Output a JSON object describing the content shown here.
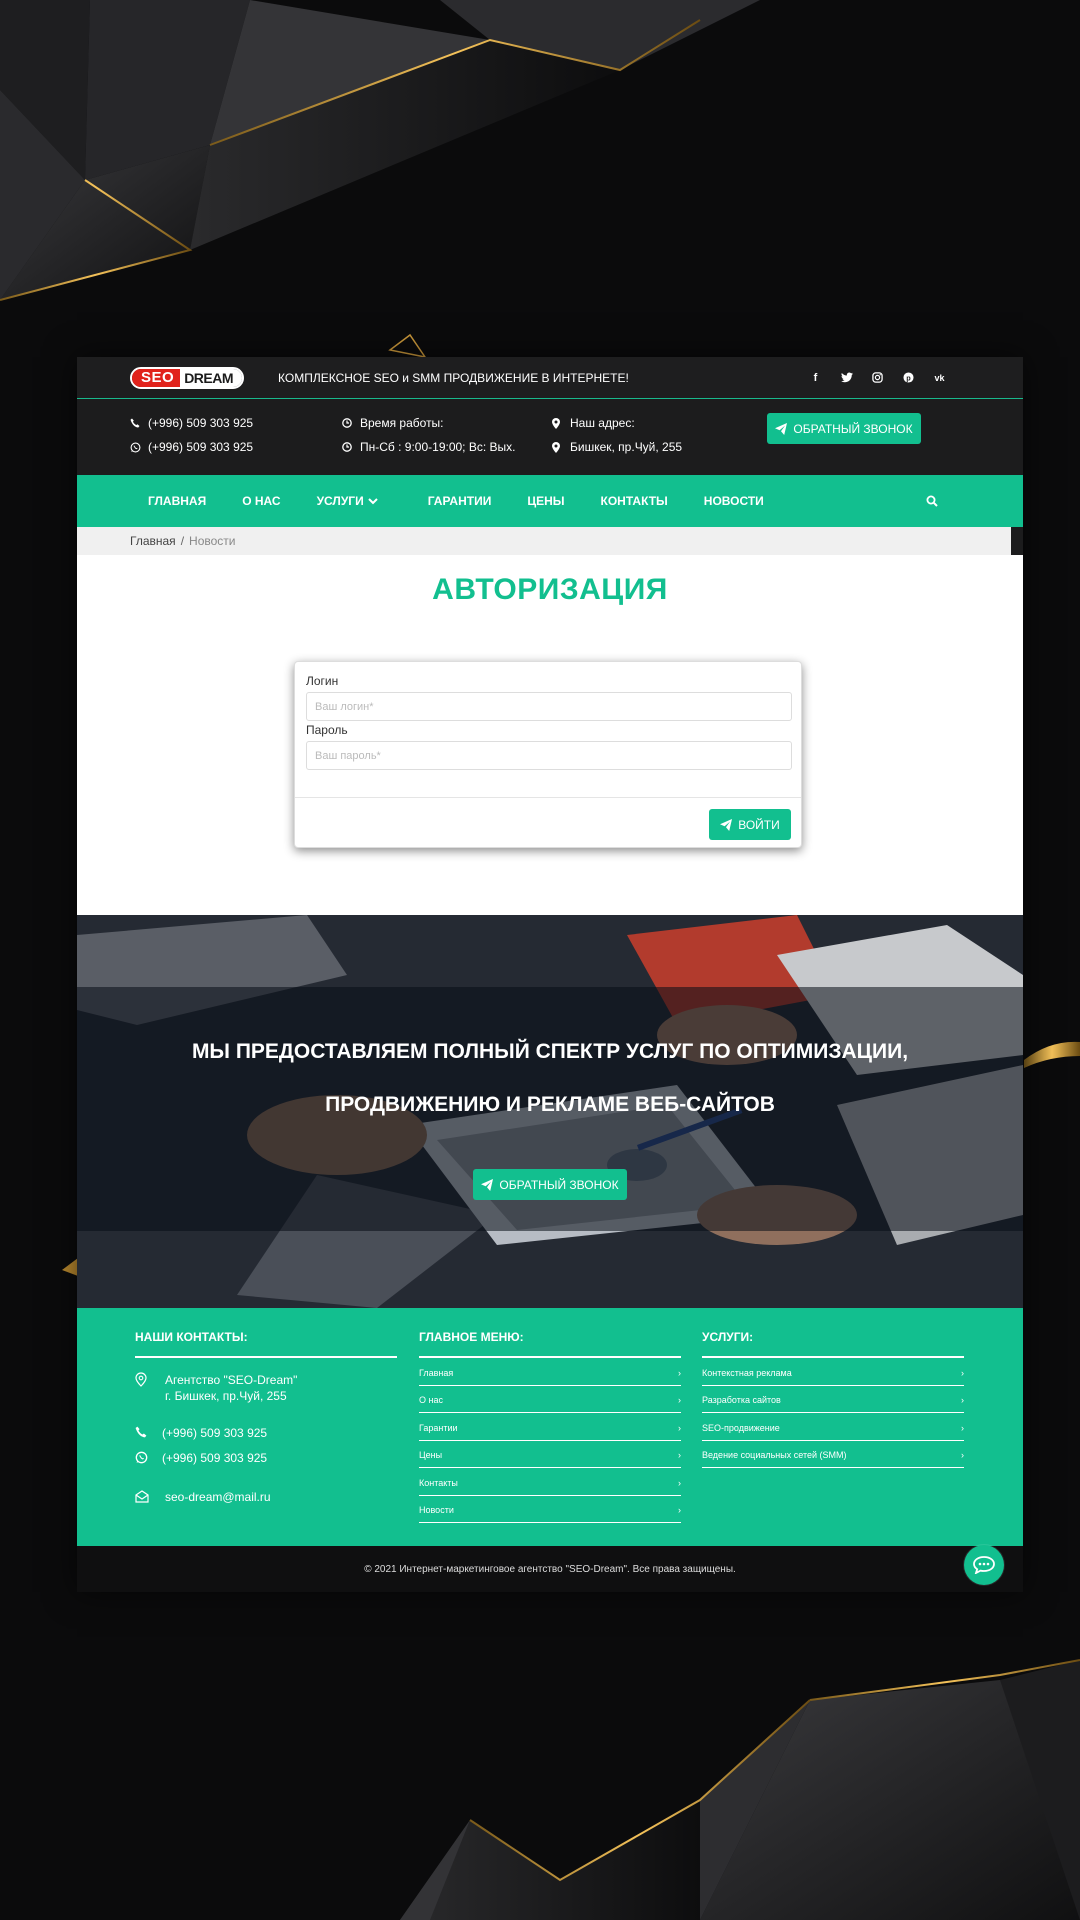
{
  "header": {
    "logo": {
      "seo": "SEO",
      "dream": "DREAM"
    },
    "tagline": "КОМПЛЕКСНОЕ SEO и SMM ПРОДВИЖЕНИЕ В ИНТЕРНЕТЕ!",
    "socials": [
      "facebook-icon",
      "twitter-icon",
      "instagram-icon",
      "pinterest-icon",
      "vk-icon"
    ]
  },
  "info": {
    "phone1": "(+996) 509 303 925",
    "phone2": "(+996) 509 303 925",
    "hours_label": "Время работы:",
    "hours_value": "Пн-Сб : 9:00-19:00; Вс: Вых.",
    "address_label": "Наш адрес:",
    "address_value": "Бишкек, пр.Чуй, 255",
    "callback_button": "ОБРАТНЫЙ ЗВОНОК"
  },
  "nav": {
    "items": [
      "ГЛАВНАЯ",
      "О НАС",
      "УСЛУГИ",
      "ГАРАНТИИ",
      "ЦЕНЫ",
      "КОНТАКТЫ",
      "НОВОСТИ"
    ]
  },
  "breadcrumb": {
    "home": "Главная",
    "separator": "/",
    "current": "Новости"
  },
  "login": {
    "title": "АВТОРИЗАЦИЯ",
    "login_label": "Логин",
    "login_placeholder": "Ваш логин*",
    "password_label": "Пароль",
    "password_placeholder": "Ваш пароль*",
    "submit": "ВОЙТИ"
  },
  "promo": {
    "line1": "МЫ ПРЕДОСТАВЛЯЕМ ПОЛНЫЙ СПЕКТР УСЛУГ ПО ОПТИМИЗАЦИИ,",
    "line2": "ПРОДВИЖЕНИЮ И РЕКЛАМЕ ВЕБ-САЙТОВ",
    "button": "ОБРАТНЫЙ ЗВОНОК"
  },
  "footer": {
    "contacts": {
      "title": "НАШИ КОНТАКТЫ:",
      "company": "Агентство \"SEO-Dream\"",
      "address": "г. Бишкек, пр.Чуй, 255",
      "phone1": "(+996) 509 303 925",
      "phone2": "(+996) 509 303 925",
      "email": "seo-dream@mail.ru"
    },
    "menu": {
      "title": "ГЛАВНОЕ МЕНЮ:",
      "items": [
        "Главная",
        "О нас",
        "Гарантии",
        "Цены",
        "Контакты",
        "Новости"
      ]
    },
    "services": {
      "title": "УСЛУГИ:",
      "items": [
        "Контекстная реклама",
        "Разработка сайтов",
        "SEO-продвижение",
        "Ведение социальных сетей (SMM)"
      ]
    },
    "copyright": "© 2021 Интернет-маркетинговое агентство \"SEO-Dream\". Все права защищены."
  },
  "colors": {
    "accent": "#12bf8f",
    "logo_red": "#e1221b",
    "dark": "#1c1c1d"
  }
}
